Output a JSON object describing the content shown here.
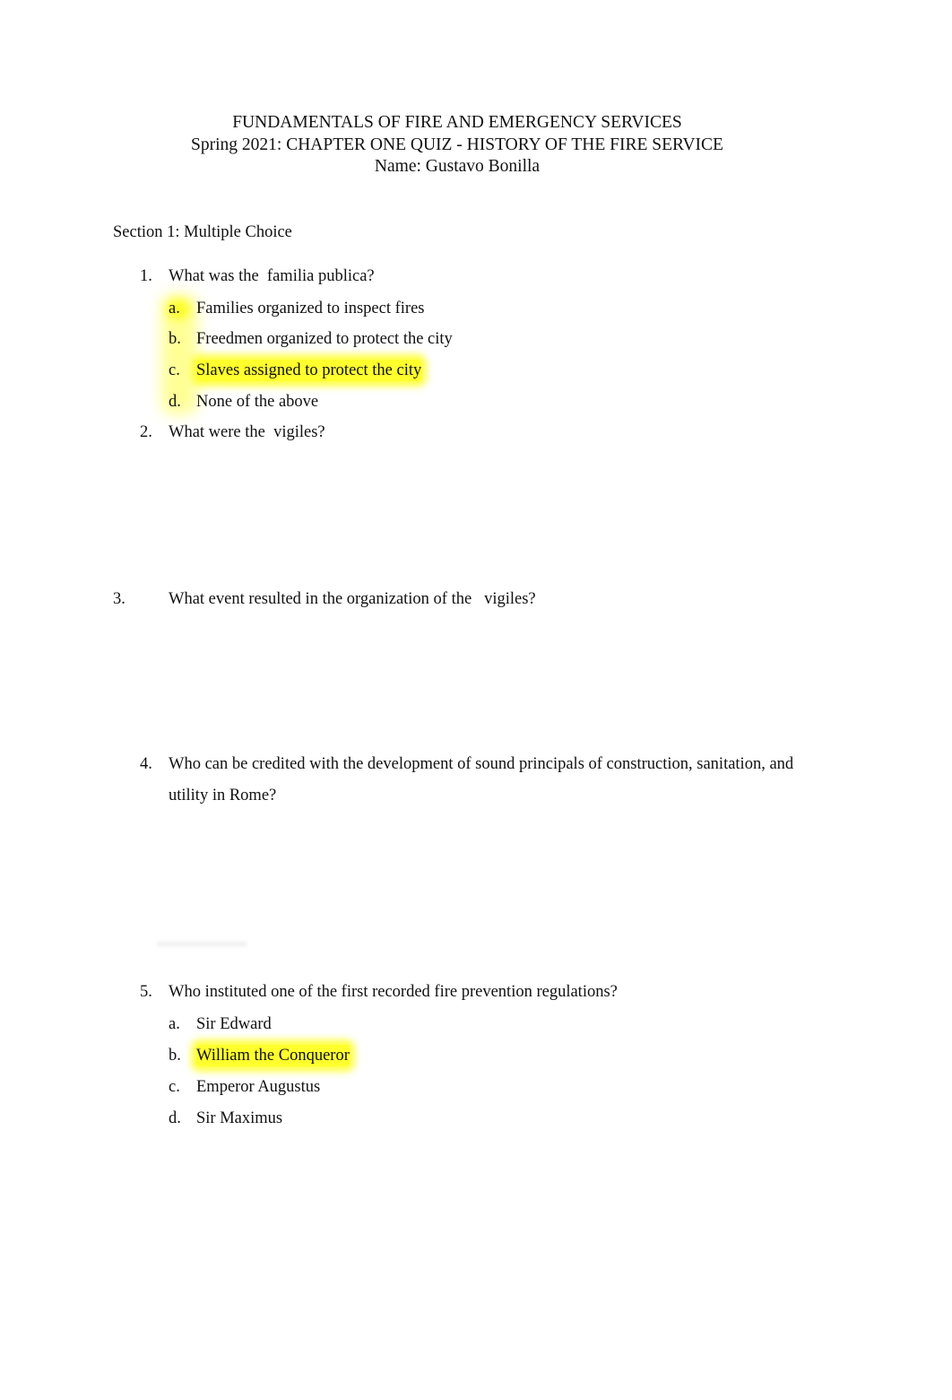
{
  "header": {
    "title": "FUNDAMENTALS OF FIRE AND EMERGENCY SERVICES",
    "subtitle": "Spring 2021: CHAPTER ONE QUIZ - HISTORY OF THE FIRE SERVICE",
    "name_line": "Name: Gustavo Bonilla"
  },
  "section": {
    "title": "Section 1: Multiple Choice"
  },
  "highlight_color": "#ffff2e",
  "questions": [
    {
      "number": "1.",
      "text": "What was the  familia publica?",
      "options": [
        {
          "letter": "a.",
          "text": "Families organized to inspect fires",
          "highlighted": false
        },
        {
          "letter": "b.",
          "text": "Freedmen organized to protect the city",
          "highlighted": false
        },
        {
          "letter": "c.",
          "text": "Slaves assigned to protect the city",
          "highlighted": true
        },
        {
          "letter": "d.",
          "text": "None of the above",
          "highlighted": false
        }
      ]
    },
    {
      "number": "2.",
      "text": "What were the  vigiles?"
    },
    {
      "number": "3.",
      "text": "What event resulted in the organization of the   vigiles?"
    },
    {
      "number": "4.",
      "text": "Who can be credited with the development of sound principals of construction, sanitation, and",
      "text_line2": "utility in Rome?"
    },
    {
      "number": "5.",
      "text": "Who instituted one of the first recorded fire prevention regulations?",
      "options": [
        {
          "letter": "a.",
          "text": "Sir Edward",
          "highlighted": false
        },
        {
          "letter": "b.",
          "text": "William the Conqueror",
          "highlighted": true
        },
        {
          "letter": "c.",
          "text": "Emperor Augustus",
          "highlighted": false
        },
        {
          "letter": "d.",
          "text": "Sir Maximus",
          "highlighted": false
        }
      ]
    }
  ]
}
